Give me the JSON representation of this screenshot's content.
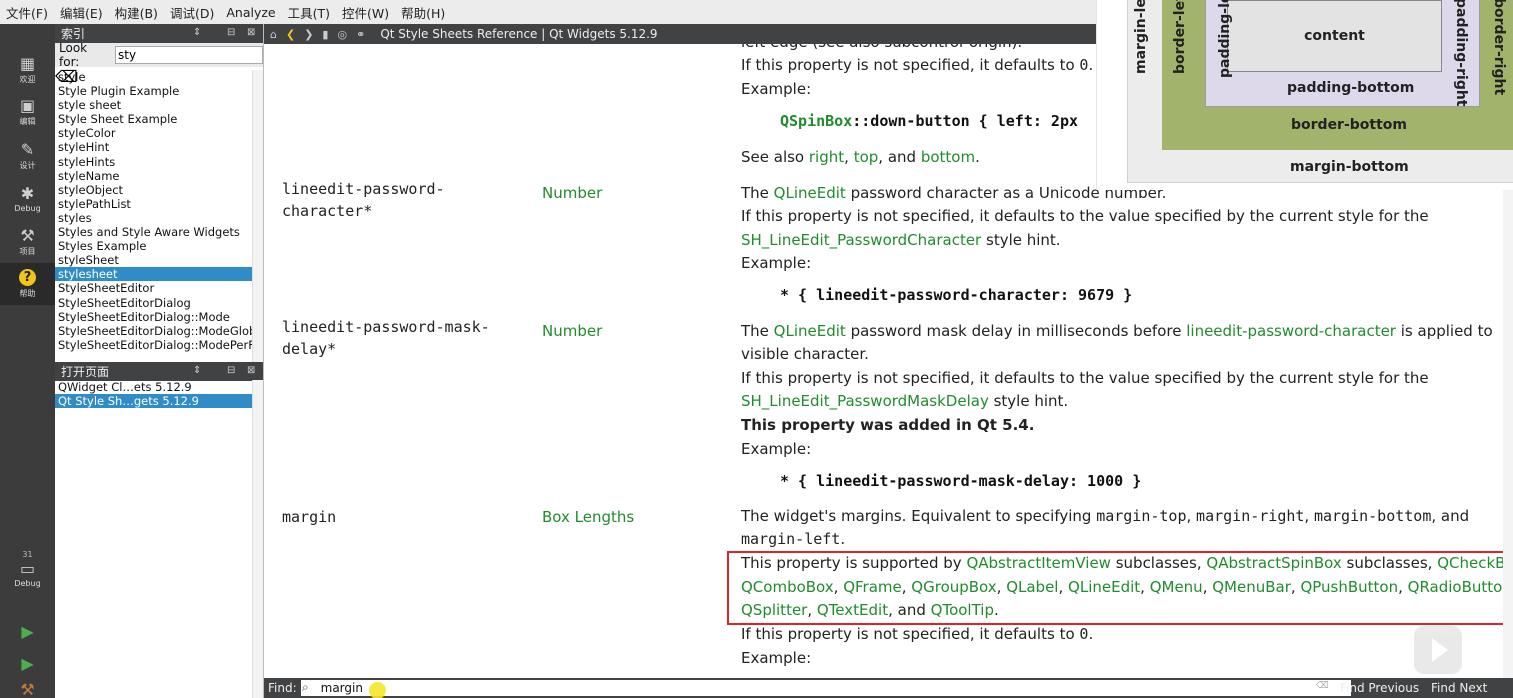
{
  "menu": [
    "文件(F)",
    "编辑(E)",
    "构建(B)",
    "调试(D)",
    "Analyze",
    "工具(T)",
    "控件(W)",
    "帮助(H)"
  ],
  "modes": [
    {
      "label": "欢迎",
      "icon": "grid-icon"
    },
    {
      "label": "编辑",
      "icon": "edit-icon"
    },
    {
      "label": "设计",
      "icon": "pencil-icon"
    },
    {
      "label": "Debug",
      "icon": "bug-icon"
    },
    {
      "label": "项目",
      "icon": "wrench-icon"
    },
    {
      "label": "帮助",
      "icon": "help-icon"
    }
  ],
  "kit": {
    "number": "31",
    "label": "Debug"
  },
  "index_panel": {
    "title": "索引",
    "look_for_label": "Look for:",
    "search_value": "sty",
    "items": [
      "style",
      "Style Plugin Example",
      "style sheet",
      "Style Sheet Example",
      "styleColor",
      "styleHint",
      "styleHints",
      "styleName",
      "styleObject",
      "stylePathList",
      "styles",
      "Styles and Style Aware Widgets",
      "Styles Example",
      "styleSheet",
      "stylesheet",
      "StyleSheetEditor",
      "StyleSheetEditorDialog",
      "StyleSheetEditorDialog::Mode",
      "StyleSheetEditorDialog::ModeGlobal",
      "StyleSheetEditorDialog::ModePerF"
    ],
    "selected_index": 14
  },
  "open_pages": {
    "title": "打开页面",
    "items": [
      "QWidget Cl…ets 5.12.9",
      "Qt Style Sh…gets 5.12.9"
    ],
    "selected_index": 1
  },
  "doc_toolbar": {
    "title": "Qt Style Sheets Reference | Qt Widgets 5.12.9"
  },
  "box_model": {
    "content": "content",
    "padding_left": "padding-left",
    "padding_right": "padding-right",
    "padding_bottom": "padding-bottom",
    "border_left": "border-left",
    "border_right": "border-right",
    "border_bottom": "border-bottom",
    "margin_left": "margin-left",
    "margin_bottom": "margin-bottom"
  },
  "doc": {
    "top_partial": "left edge (see also subcontrol-origin).",
    "top_default": "If this property is not specified, it defaults to ",
    "top_default_val": "0",
    "top_example": "Example:",
    "top_code_class": "QSpinBox",
    "top_code_rest": "::down-button { left: 2px",
    "see_also": "See also",
    "see_right": "right",
    "see_top": "top",
    "see_and": "and",
    "see_bottom": "bottom",
    "rows": {
      "pw_char": {
        "name": "lineedit-password-\ncharacter*",
        "type": "Number",
        "d1_a": "The ",
        "d1_link": "QLineEdit",
        "d1_b": " password character as a Unicode number.",
        "d2": "If this property is not specified, it defaults to the value specified by the current style for the",
        "d3_link": "SH_LineEdit_PasswordCharacter",
        "d3_b": " style hint.",
        "example": "Example:",
        "code": "* { lineedit-password-character: 9679 }"
      },
      "pw_delay": {
        "name": "lineedit-password-mask-\ndelay*",
        "type": "Number",
        "d1_a": "The ",
        "d1_link": "QLineEdit",
        "d1_b": " password mask delay in milliseconds before ",
        "d1_link2": "lineedit-password-character",
        "d1_c": " is applied to",
        "d2": "visible character.",
        "d3": "If this property is not specified, it defaults to the value specified by the current style for the",
        "d4_link": "SH_LineEdit_PasswordMaskDelay",
        "d4_b": " style hint.",
        "added": "This property was added in Qt 5.4.",
        "example": "Example:",
        "code": "* { lineedit-password-mask-delay: 1000 }"
      },
      "margin": {
        "name": "margin",
        "type": "Box Lengths",
        "d1_a": "The widget's margins. Equivalent to specifying ",
        "m_top": "margin-top",
        "m_right": "margin-right",
        "m_bottom": "margin-bottom",
        "and": ", and",
        "m_left": "margin-left",
        "supported_prefix": "This property is supported by ",
        "classes_line1": [
          "QAbstractItemView",
          "QAbstractSpinBox",
          "QCheckBox"
        ],
        "subclasses": " subclasses, ",
        "classes_line2": [
          "QComboBox",
          "QFrame",
          "QGroupBox",
          "QLabel",
          "QLineEdit",
          "QMenu",
          "QMenuBar",
          "QPushButton",
          "QRadioButton"
        ],
        "classes_line3a": "QSplitter",
        "classes_line3b": "QTextEdit",
        "and_word": "and",
        "classes_line3c": "QToolTip",
        "default_text": "If this property is not specified, it defaults to ",
        "default_val": "0",
        "example": "Example:"
      }
    }
  },
  "find_bar": {
    "label": "Find:",
    "value": "margin",
    "find_previous": "Find Previous",
    "find_next": "Find Next"
  }
}
